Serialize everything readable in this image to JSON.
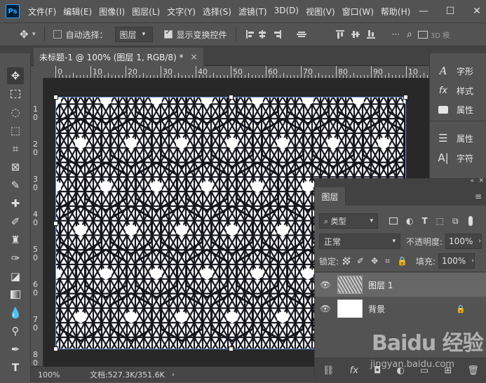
{
  "app": {
    "logo": "Ps"
  },
  "menu": [
    "文件(F)",
    "编辑(E)",
    "图像(I)",
    "图层(L)",
    "文字(Y)",
    "选择(S)",
    "滤镜(T)",
    "3D(D)",
    "视图(V)",
    "窗口(W)",
    "帮助(H)"
  ],
  "options": {
    "auto_select_label": "自动选择：",
    "layer_select": "图层",
    "show_transform_label": "显示变换控件",
    "mode_3d": "3D 模"
  },
  "document": {
    "tab_title": "未标题-1 @ 100% (图层 1, RGB/8) *",
    "close": "×"
  },
  "ruler": {
    "top_ticks": [
      "0",
      "10",
      "20",
      "30",
      "40",
      "50",
      "60",
      "70",
      "80",
      "90",
      "10"
    ],
    "left_ticks": [
      "1\n0",
      "2\n0",
      "3\n0",
      "4\n0",
      "5\n0",
      "6\n0",
      "7\n0",
      "8\n0"
    ]
  },
  "status": {
    "zoom": "100%",
    "doc": "文档:527.3K/351.6K"
  },
  "right_panel": {
    "items": [
      {
        "icon": "character-icon",
        "label": "字形"
      },
      {
        "icon": "fx-icon",
        "label": "样式"
      },
      {
        "icon": "properties-icon",
        "label": "属性"
      },
      {
        "icon": "adjust-icon",
        "label": "属性"
      },
      {
        "icon": "text-icon",
        "label": "字符"
      }
    ]
  },
  "layers_panel": {
    "tab": "图层",
    "filter": "类型",
    "blend": "正常",
    "opacity_label": "不透明度:",
    "opacity": "100%",
    "lock_label": "锁定:",
    "fill_label": "填充:",
    "fill": "100%",
    "layers": [
      {
        "name": "图层 1",
        "active": true
      },
      {
        "name": "背景",
        "active": false
      }
    ]
  },
  "watermark": {
    "brand": "Baidu 经验",
    "url": "jingyan.baidu.com"
  }
}
